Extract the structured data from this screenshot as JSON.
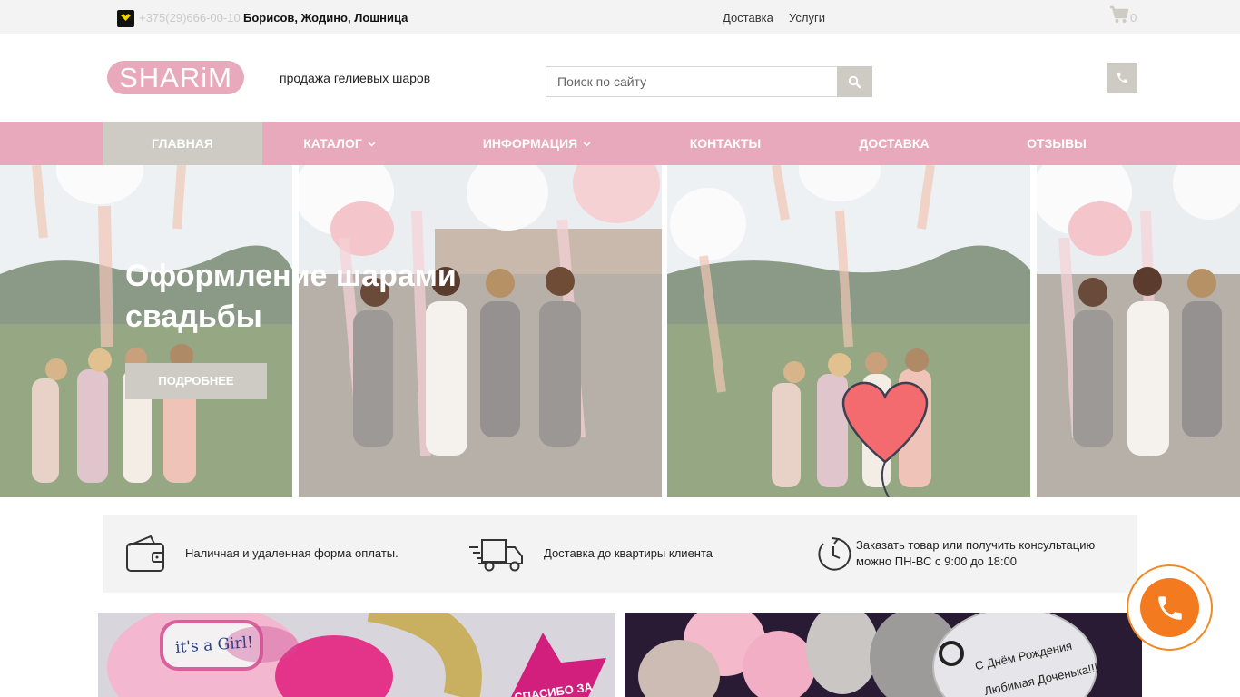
{
  "topbar": {
    "phone": "+375(29)666-00-10",
    "cities": "Борисов, Жодино, Лошница",
    "links": [
      "Доставка",
      "Услуги"
    ],
    "cart_count": "0"
  },
  "header": {
    "logo_text": "SHARiM",
    "slogan": "продажа гелиевых шаров",
    "search_placeholder": "Поиск по сайту"
  },
  "nav": {
    "items": [
      "Главная",
      "Каталог",
      "Информация",
      "Контакты",
      "Доставка",
      "Отзывы"
    ]
  },
  "hero": {
    "title_line1": "Оформление шарами",
    "title_line2": "свадьбы",
    "button": "ПОДРОБНЕЕ"
  },
  "features": [
    {
      "icon": "wallet-icon",
      "text": "Наличная и удаленная форма оплаты."
    },
    {
      "icon": "truck-icon",
      "text": "Доставка до квартиры клиента"
    },
    {
      "icon": "clock-icon",
      "line1": "Заказать товар или получить консультацию",
      "line2": "можно ПН-ВС с 9:00 до 18:00"
    }
  ],
  "products": [
    {
      "badge": "it's a Girl!",
      "caption": "СПАСИБО ЗА"
    },
    {
      "caption_1": "С Днём Рождения",
      "caption_2": "Любимая Доченька!!!"
    }
  ],
  "colors": {
    "pink": "#e8a9bd",
    "gray_accent": "#cdcbc3",
    "orange": "#f47a1f"
  }
}
